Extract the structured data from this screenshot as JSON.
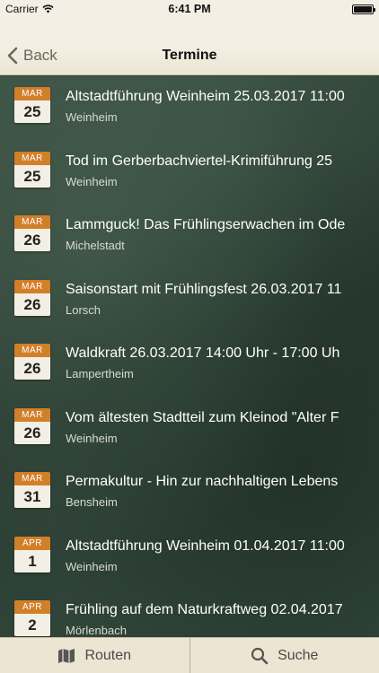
{
  "status": {
    "carrier": "Carrier",
    "time": "6:41 PM"
  },
  "nav": {
    "back_label": "Back",
    "title": "Termine"
  },
  "events": [
    {
      "month": "MAR",
      "day": "25",
      "title": "Altstadtführung Weinheim 25.03.2017 11:00",
      "place": "Weinheim"
    },
    {
      "month": "MAR",
      "day": "25",
      "title": "Tod im Gerberbachviertel-Krimiführung 25",
      "place": "Weinheim"
    },
    {
      "month": "MAR",
      "day": "26",
      "title": "Lammguck! Das Frühlingserwachen im Ode",
      "place": "Michelstadt"
    },
    {
      "month": "MAR",
      "day": "26",
      "title": "Saisonstart mit Frühlingsfest 26.03.2017 11",
      "place": "Lorsch"
    },
    {
      "month": "MAR",
      "day": "26",
      "title": "Waldkraft 26.03.2017 14:00 Uhr - 17:00 Uh",
      "place": "Lampertheim"
    },
    {
      "month": "MAR",
      "day": "26",
      "title": "Vom ältesten Stadtteil zum Kleinod \"Alter F",
      "place": "Weinheim"
    },
    {
      "month": "MAR",
      "day": "31",
      "title": "Permakultur - Hin zur nachhaltigen Lebens",
      "place": "Bensheim"
    },
    {
      "month": "APR",
      "day": "1",
      "title": "Altstadtführung Weinheim 01.04.2017 11:00",
      "place": "Weinheim"
    },
    {
      "month": "APR",
      "day": "2",
      "title": "Frühling auf dem Naturkraftweg 02.04.2017",
      "place": "Mörlenbach"
    }
  ],
  "tabs": {
    "routes_label": "Routen",
    "search_label": "Suche"
  },
  "colors": {
    "accent": "#d27f2a",
    "bar": "#ece5d3"
  },
  "icons": {
    "back": "chevron-left-icon",
    "routes": "map-icon",
    "search": "search-icon"
  }
}
